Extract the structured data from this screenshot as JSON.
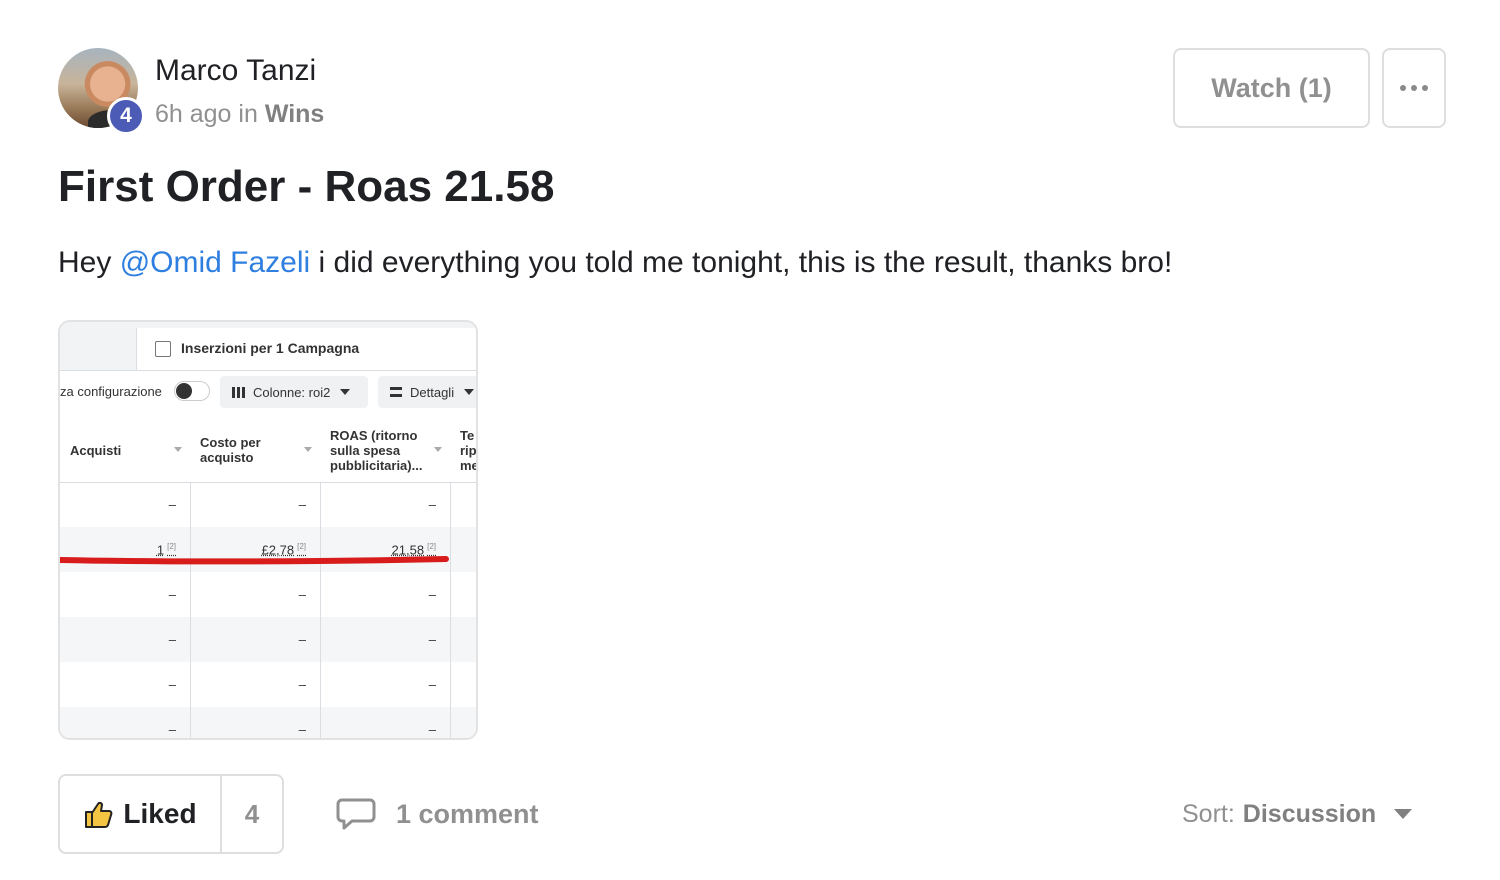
{
  "post": {
    "author": "Marco Tanzi",
    "level": "4",
    "time": "6h ago",
    "in_label": "in",
    "category": "Wins",
    "title": "First Order - Roas 21.58",
    "body": {
      "prefix": "Hey ",
      "mention": "@Omid Fazeli",
      "suffix": " i did everything you told me tonight, this is the result, thanks bro!"
    }
  },
  "actions": {
    "watch_label": "Watch (1)",
    "more_icon": "more-dots-icon"
  },
  "screenshot": {
    "tab_label": "Inserzioni per 1 Campagna",
    "config_label": "za configurazione",
    "columns_label": "Colonne: roi2",
    "details_label": "Dettagli",
    "headers": {
      "col1": "Acquisti",
      "col2a": "Costo per",
      "col2b": "acquisto",
      "col3a": "ROAS (ritorno",
      "col3b": "sulla spesa",
      "col3c": "pubblicitaria)...",
      "col4a": "Te",
      "col4b": "rip",
      "col4c": "me"
    },
    "dash": "–",
    "values": {
      "acquisti": "1",
      "costo": "£2,78",
      "roas": "21,58",
      "marker": "[2]"
    }
  },
  "footer": {
    "like_label": "Liked",
    "like_count": "4",
    "comment_label": "1 comment",
    "sort_label": "Sort:",
    "sort_value": "Discussion"
  }
}
